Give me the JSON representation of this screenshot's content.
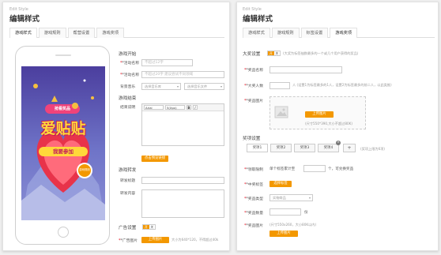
{
  "left": {
    "eyebrow": "Edit Style",
    "title": "编辑样式",
    "tabs": [
      "游戏样式",
      "游戏规则",
      "帮营设置",
      "游戏奖项"
    ],
    "preview": {
      "badge": "抢看奖品",
      "headline": "爱贴贴",
      "join": "我要参加",
      "rule": "游戏规则"
    },
    "start": {
      "heading": "游戏开始",
      "name_label": "*活动名称",
      "name_placeholder": "不超过12字",
      "cond_label": "*活动名称",
      "cond_placeholder": "不超过20字",
      "cond_placeholder2": "建议尝试不同领域",
      "bg_label": "背景音乐",
      "music_select": "选择音乐库",
      "file_select": "选择音乐文件"
    },
    "end": {
      "heading": "游戏结束",
      "content_label": "结束说明",
      "toolbar": {
        "font": "Arial",
        "size": "5(Xpx)",
        "bold": "B",
        "italic": "I"
      },
      "btn": "点击预览链接"
    },
    "share": {
      "heading": "游戏转发",
      "title_label": "转发标题",
      "content_label": "转发内容"
    },
    "ad": {
      "setting_label": "广告设置",
      "toggle_on": "开启",
      "toggle_off": "关",
      "img_label": "*广告图片",
      "upload_btn": "上传图片",
      "hint": "大小为640*120，不得超过40k"
    }
  },
  "right": {
    "eyebrow": "Edit Style",
    "title": "编辑样式",
    "tabs": [
      "游戏样式",
      "游戏规则",
      "标签设置",
      "游戏奖项"
    ],
    "big": {
      "heading": "大奖设置",
      "toggle_on": "开启",
      "toggle_off": "关",
      "note": "(大奖为标签抽数最多的一个或几个用户获得的奖品)",
      "name_label": "*奖品名称",
      "count_label": "*大奖人数",
      "count_hint": "人 (设置1为标签最多的1人，设置2为标签最多的前二人，以此类推)",
      "img_label": "*奖品图片",
      "upload_btn": "上传图片",
      "img_hint": "(尺寸550*390,大小不超过80K)"
    },
    "prizes": {
      "heading": "奖项设置",
      "tabs": [
        "奖项1",
        "奖项2",
        "奖项3",
        "奖项4"
      ],
      "add": "+",
      "limit_hint": "(奖项上限为6项)",
      "limit_label": "*领取限制",
      "limit_text": "单个标签累计至",
      "limit_suffix": "个，可兑换奖品",
      "tag_label": "*中奖标签",
      "tag_btn": "选择标签",
      "type_label": "*奖品类型",
      "type_select": "实物商品",
      "qty_label": "*奖品数量",
      "qty_unit": "份",
      "img_label": "*奖品图片",
      "img_hint": "(尺寸550x260，大小80K以内)",
      "upload_btn": "上传图片"
    }
  },
  "colors": {
    "accent": "#f39800",
    "required": "#e60012"
  }
}
